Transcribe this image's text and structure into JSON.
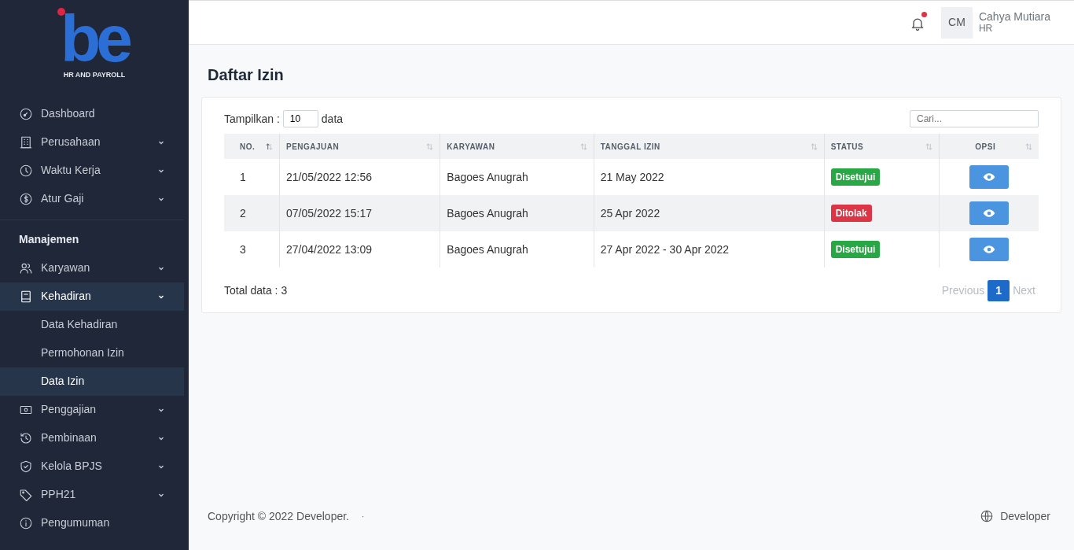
{
  "sidebar": {
    "logo": {
      "letters": "be",
      "tagline": "HR AND PAYROLL"
    },
    "groups": [
      {
        "items": [
          {
            "label": "Dashboard",
            "expandable": false,
            "selected": false
          },
          {
            "label": "Perusahaan",
            "expandable": true,
            "selected": false
          },
          {
            "label": "Waktu Kerja",
            "expandable": true,
            "selected": false
          },
          {
            "label": "Atur Gaji",
            "expandable": true,
            "selected": false
          }
        ]
      },
      {
        "heading": "Manajemen",
        "items": [
          {
            "label": "Karyawan",
            "expandable": true,
            "selected": false
          },
          {
            "label": "Kehadiran",
            "expandable": true,
            "selected": true,
            "children": [
              {
                "label": "Data Kehadiran",
                "selected": false
              },
              {
                "label": "Permohonan Izin",
                "selected": false
              },
              {
                "label": "Data Izin",
                "selected": true
              }
            ]
          },
          {
            "label": "Penggajian",
            "expandable": true,
            "selected": false
          },
          {
            "label": "Pembinaan",
            "expandable": true,
            "selected": false
          },
          {
            "label": "Kelola BPJS",
            "expandable": true,
            "selected": false
          },
          {
            "label": "PPH21",
            "expandable": true,
            "selected": false
          },
          {
            "label": "Pengumuman",
            "expandable": false,
            "selected": false
          }
        ]
      }
    ]
  },
  "topbar": {
    "notification_dot": true,
    "user": {
      "initials": "CM",
      "name": "Cahya Mutiara",
      "role": "HR"
    }
  },
  "page_title": "Daftar Izin",
  "table_controls": {
    "show_label": "Tampilkan :",
    "page_size": "10",
    "show_suffix": "data",
    "search": {
      "placeholder": "Cari..."
    }
  },
  "table": {
    "columns": [
      {
        "label": "NO.",
        "sorted": true
      },
      {
        "label": "PENGAJUAN",
        "sorted": false
      },
      {
        "label": "KARYAWAN",
        "sorted": false
      },
      {
        "label": "TANGGAL IZIN",
        "sorted": false
      },
      {
        "label": "STATUS",
        "sorted": false
      },
      {
        "label": "OPSI",
        "sorted": false
      }
    ],
    "rows": [
      {
        "no": "1",
        "submitted": "21/05/2022 12:56",
        "employee": "Bagoes Anugrah",
        "date": "21 May 2022",
        "status": {
          "label": "Disetujui",
          "kind": "approved"
        }
      },
      {
        "no": "2",
        "submitted": "07/05/2022 15:17",
        "employee": "Bagoes Anugrah",
        "date": "25 Apr 2022",
        "status": {
          "label": "Ditolak",
          "kind": "rejected"
        }
      },
      {
        "no": "3",
        "submitted": "27/04/2022 13:09",
        "employee": "Bagoes Anugrah",
        "date": "27 Apr 2022 - 30 Apr 2022",
        "status": {
          "label": "Disetujui",
          "kind": "approved"
        }
      }
    ]
  },
  "total": "Total data : 3",
  "pagination": {
    "previous": "Previous",
    "pages": [
      {
        "label": "1",
        "selected": true
      }
    ],
    "next": "Next"
  },
  "footer": {
    "copyright": "Copyright © 2022 Developer.",
    "separator": "·",
    "link": "Developer"
  }
}
